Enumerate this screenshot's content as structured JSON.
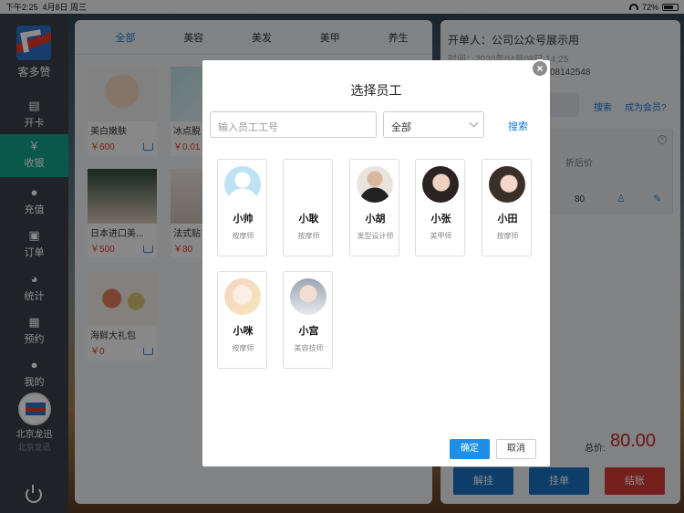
{
  "status_bar": {
    "time": "下午2:25",
    "date": "4月8日 周三",
    "battery": "72%",
    "battery_level": 0.72
  },
  "sidebar": {
    "brand": "客多赞",
    "items": [
      {
        "label": "开卡",
        "icon": "card-icon"
      },
      {
        "label": "收银",
        "icon": "cashier-icon",
        "active": true
      },
      {
        "label": "充值",
        "icon": "recharge-icon"
      },
      {
        "label": "订单",
        "icon": "order-icon"
      },
      {
        "label": "统计",
        "icon": "pie-chart-icon"
      },
      {
        "label": "预约",
        "icon": "calendar-icon"
      },
      {
        "label": "我的",
        "icon": "user-icon"
      }
    ],
    "store_name": "北京龙迅",
    "store_sub": "北京龙迅"
  },
  "products": {
    "tabs": [
      "全部",
      "美容",
      "美发",
      "美甲",
      "养生"
    ],
    "items": [
      {
        "name": "美白嫩肤",
        "price": "￥600"
      },
      {
        "name": "冰点脱",
        "price": "￥0.01"
      },
      {
        "name": "日本进口美...",
        "price": "￥500"
      },
      {
        "name": "法式贴",
        "price": "￥80"
      },
      {
        "name": "海鲜大礼包",
        "price": "￥0"
      }
    ]
  },
  "order": {
    "opener": "开单人：公司公众号展示用",
    "time": "时间：2020年04月08日 14:25",
    "phone": "08142548",
    "search_label": "搜索",
    "member_label": "成为会员?",
    "discount_header": "折后价",
    "item_value": "80",
    "total_label": "总价:",
    "total_value": "80.00",
    "buttons": [
      "解挂",
      "挂单",
      "结账"
    ]
  },
  "modal": {
    "title": "选择员工",
    "input_placeholder": "输入员工工号",
    "select_value": "全部",
    "search_label": "搜索",
    "close_label": "×",
    "employees": [
      {
        "name": "小帅",
        "role": "按摩师"
      },
      {
        "name": "小耿",
        "role": "按摩师"
      },
      {
        "name": "小胡",
        "role": "发型设计师"
      },
      {
        "name": "小张",
        "role": "美甲师"
      },
      {
        "name": "小田",
        "role": "按摩师"
      },
      {
        "name": "小咪",
        "role": "按摩师"
      },
      {
        "name": "小宫",
        "role": "美容技师"
      }
    ],
    "confirm_label": "确定",
    "cancel_label": "取消"
  },
  "colors": {
    "accent": "#1d8fe6",
    "active_nav": "#13a08a",
    "price": "#e23c2a",
    "checkout": "#d73a3a",
    "order_btn": "#1a6fc0"
  }
}
